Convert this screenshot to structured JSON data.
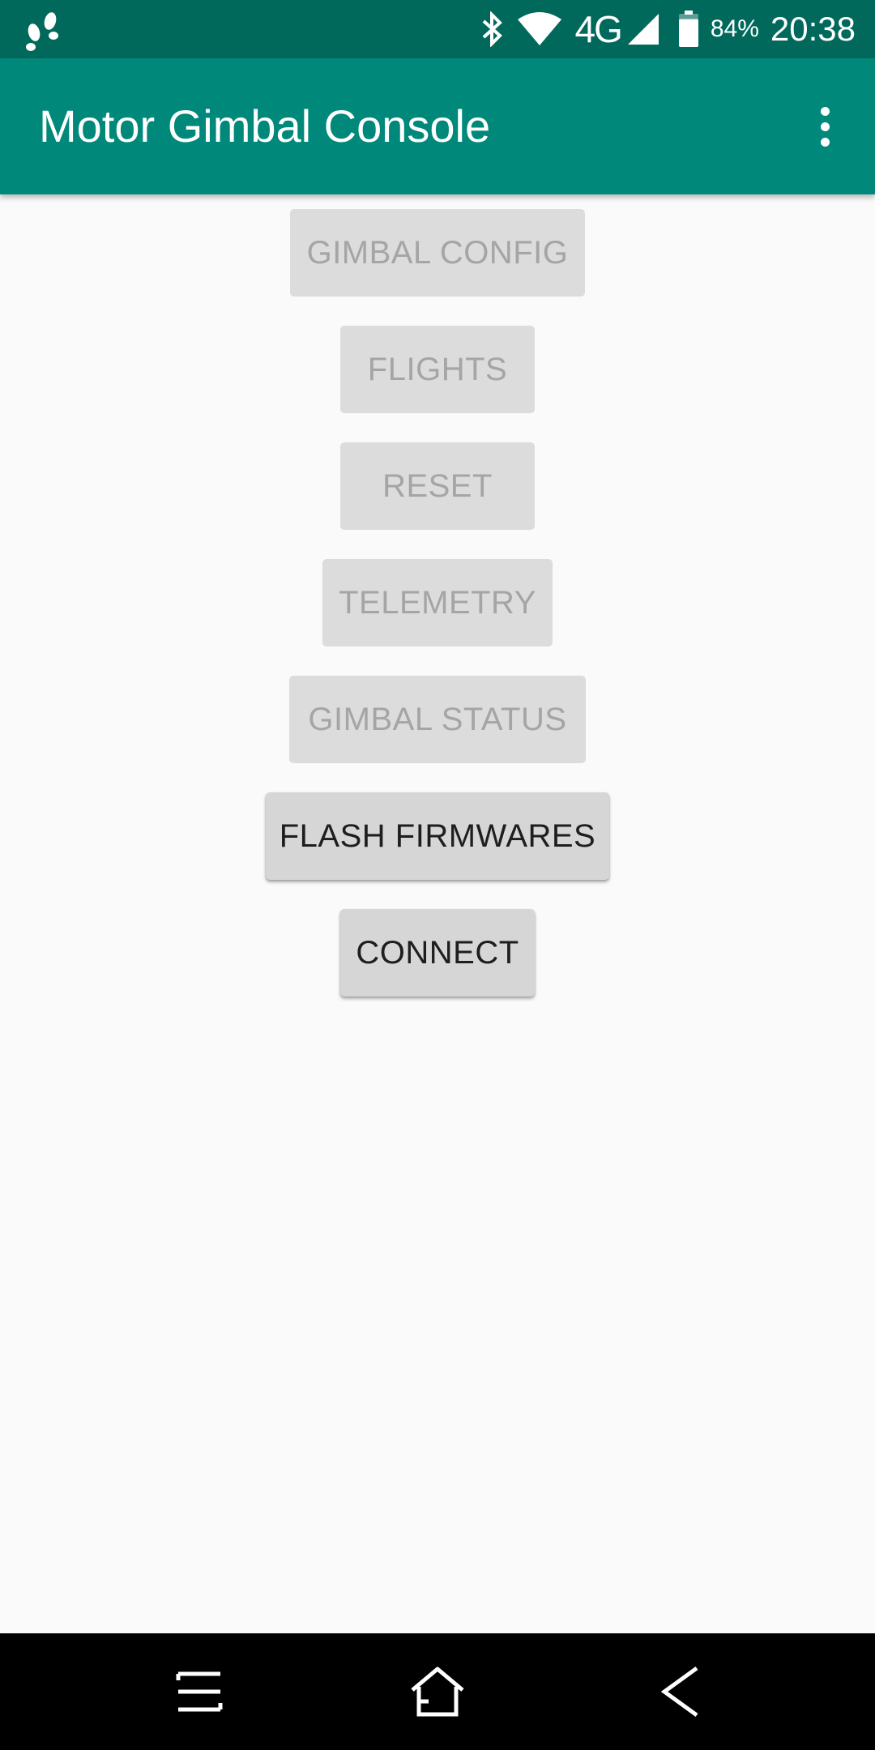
{
  "status_bar": {
    "battery_percent": "84%",
    "network": "4G",
    "time": "20:38",
    "battery_level": 0.84,
    "icons": [
      "footsteps-icon",
      "bluetooth-icon",
      "wifi-icon",
      "cell-signal-icon",
      "battery-icon"
    ]
  },
  "app_bar": {
    "title": "Motor Gimbal Console",
    "overflow_icon": "more-vert-icon",
    "background": "#00897b",
    "status_background": "#00695c"
  },
  "buttons": [
    {
      "label": "GIMBAL CONFIG",
      "enabled": false
    },
    {
      "label": "FLIGHTS",
      "enabled": false
    },
    {
      "label": "RESET",
      "enabled": false
    },
    {
      "label": "TELEMETRY",
      "enabled": false
    },
    {
      "label": "GIMBAL STATUS",
      "enabled": false
    },
    {
      "label": "FLASH FIRMWARES",
      "enabled": true
    },
    {
      "label": "CONNECT",
      "enabled": true
    }
  ],
  "nav_bar": {
    "icons": [
      "menu-icon",
      "home-icon",
      "back-icon"
    ]
  }
}
